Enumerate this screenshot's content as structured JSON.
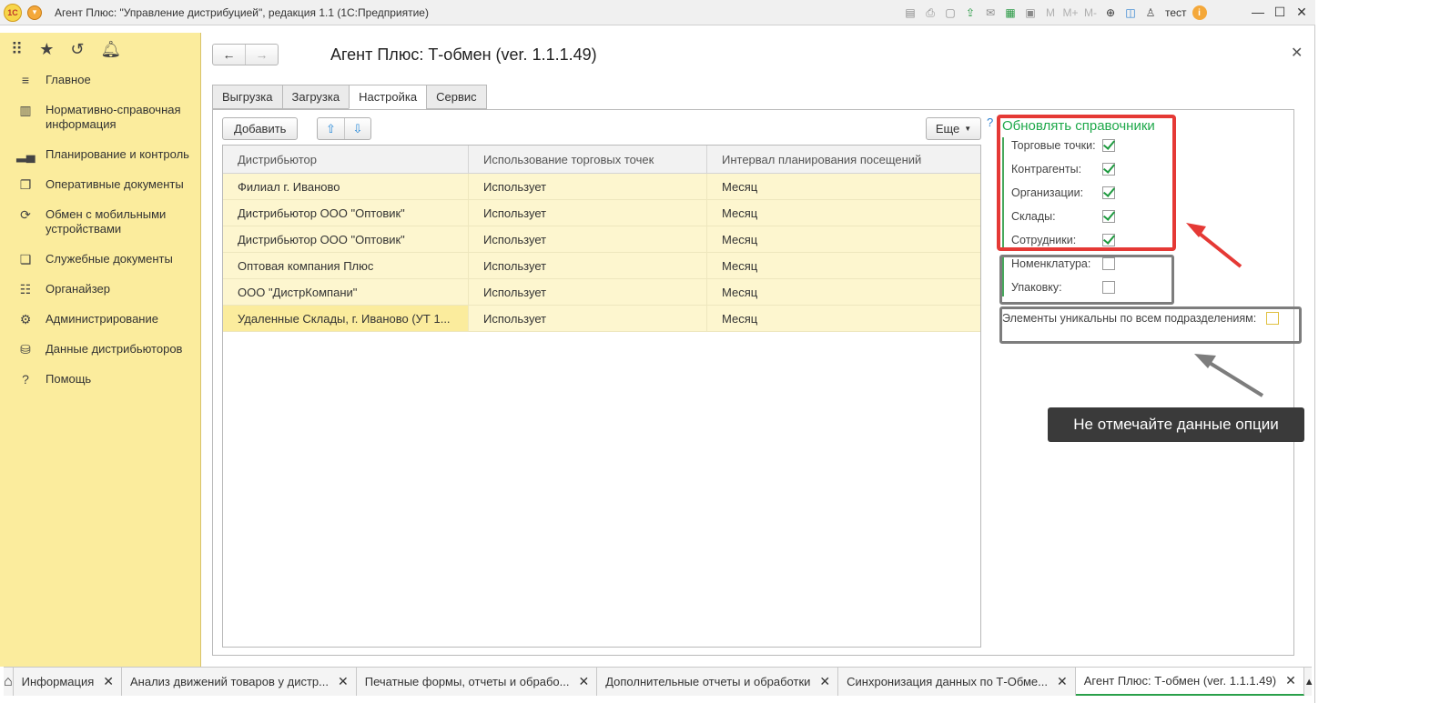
{
  "window": {
    "title": "Агент Плюс: \"Управление дистрибуцией\", редакция 1.1  (1С:Предприятие)",
    "logo": "1С",
    "user": "тест",
    "toolbar_letters": [
      "M",
      "M+",
      "M-"
    ]
  },
  "sidebar": {
    "items": [
      {
        "label": "Главное",
        "icon": "menu-lines-icon"
      },
      {
        "label": "Нормативно-справочная информация",
        "icon": "catalog-icon"
      },
      {
        "label": "Планирование и контроль",
        "icon": "chart-icon"
      },
      {
        "label": "Оперативные документы",
        "icon": "documents-icon"
      },
      {
        "label": "Обмен с мобильными устройствами",
        "icon": "sync-icon"
      },
      {
        "label": "Служебные документы",
        "icon": "service-docs-icon"
      },
      {
        "label": "Органайзер",
        "icon": "organizer-icon"
      },
      {
        "label": "Администрирование",
        "icon": "gear-icon"
      },
      {
        "label": "Данные дистрибьюторов",
        "icon": "distributor-data-icon"
      },
      {
        "label": "Помощь",
        "icon": "help-icon"
      }
    ]
  },
  "form": {
    "title": "Агент Плюс: Т-обмен (ver. 1.1.1.49)",
    "tabs": [
      "Выгрузка",
      "Загрузка",
      "Настройка",
      "Сервис"
    ],
    "active_tab": "Настройка",
    "add_label": "Добавить",
    "more_label": "Еще",
    "help": "?"
  },
  "table": {
    "columns": [
      "Дистрибьютор",
      "Использование торговых точек",
      "Интервал планирования посещений"
    ],
    "rows": [
      [
        "Филиал г. Иваново",
        "Использует",
        "Месяц"
      ],
      [
        "Дистрибьютор ООО \"Оптовик\"",
        "Использует",
        "Месяц"
      ],
      [
        "Дистрибьютор ООО \"Оптовик\"",
        "Использует",
        "Месяц"
      ],
      [
        "Оптовая компания Плюс",
        "Использует",
        "Месяц"
      ],
      [
        "ООО \"ДистрКомпани\"",
        "Использует",
        "Месяц"
      ],
      [
        "Удаленные Склады, г. Иваново (УТ 1...",
        "Использует",
        "Месяц"
      ]
    ]
  },
  "settings": {
    "section_title": "Обновлять справочники",
    "checked_group": [
      {
        "label": "Торговые точки:",
        "checked": true
      },
      {
        "label": "Контрагенты:",
        "checked": true
      },
      {
        "label": "Организации:",
        "checked": true
      },
      {
        "label": "Склады:",
        "checked": true
      },
      {
        "label": "Сотрудники:",
        "checked": true
      }
    ],
    "unchecked_group": [
      {
        "label": "Номенклатура:",
        "checked": false
      },
      {
        "label": "Упаковку:",
        "checked": false
      }
    ],
    "unique_label": "Элементы уникальны по всем подразделениям:",
    "unique_checked": false,
    "note": "Не отмечайте данные опции"
  },
  "bottom_tabs": [
    {
      "label": "Информация",
      "active": false
    },
    {
      "label": "Анализ движений товаров у дистр...",
      "active": false
    },
    {
      "label": "Печатные формы, отчеты и обрабо...",
      "active": false
    },
    {
      "label": "Дополнительные отчеты и обработки",
      "active": false
    },
    {
      "label": "Синхронизация данных по Т-Обме...",
      "active": false
    },
    {
      "label": "Агент Плюс: Т-обмен (ver. 1.1.1.49)",
      "active": true
    }
  ],
  "colors": {
    "sidebar_bg": "#fbec9d",
    "accent_green": "#1ea84a",
    "highlight_red": "#e53935",
    "highlight_grey": "#7d7d7d",
    "row_bg": "#fdf6cf"
  }
}
